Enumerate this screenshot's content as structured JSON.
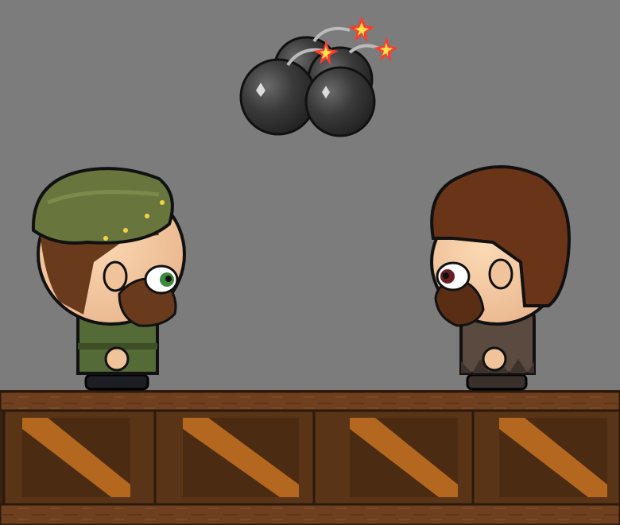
{
  "scene": {
    "background_color": "#7c7c7c",
    "floor_color": "#6b3e1c",
    "crate_count": 4
  },
  "characters": [
    {
      "id": "soldier",
      "hat": "green beret",
      "hat_color": "#68763e",
      "hair_color": "#6a3a1c",
      "eye_color": "#3d8a3f",
      "shirt_color": "#556b37",
      "facing": "right"
    },
    {
      "id": "caveman",
      "hair": "afro",
      "hair_color": "#6a3418",
      "eye_color": "#6a1f1f",
      "shirt_color": "#5a4a40",
      "facing": "left"
    }
  ],
  "projectiles": [
    {
      "type": "bomb",
      "icon": "bomb-icon",
      "lit": true
    },
    {
      "type": "bomb",
      "icon": "bomb-icon",
      "lit": true
    },
    {
      "type": "bomb",
      "icon": "bomb-icon",
      "lit": true
    },
    {
      "type": "bomb",
      "icon": "bomb-icon",
      "lit": true
    }
  ]
}
